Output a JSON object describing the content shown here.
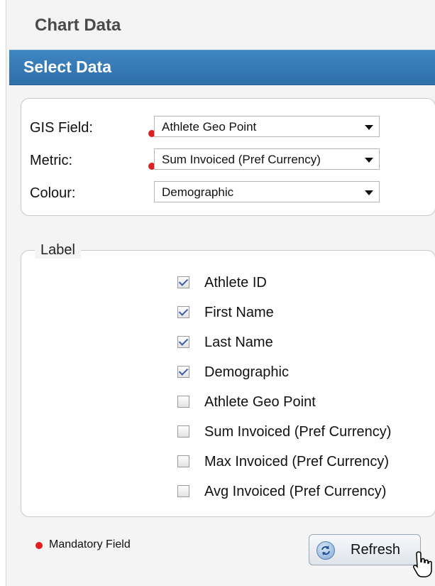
{
  "panel": {
    "title": "Chart Data"
  },
  "section": {
    "title": "Select Data"
  },
  "fields": [
    {
      "label": "GIS Field:",
      "value": "Athlete Geo Point",
      "mandatory": true
    },
    {
      "label": "Metric:",
      "value": "Sum Invoiced (Pref Currency)",
      "mandatory": true
    },
    {
      "label": "Colour:",
      "value": "Demographic",
      "mandatory": false
    }
  ],
  "label_group": {
    "legend": "Label",
    "items": [
      {
        "label": "Athlete ID",
        "checked": true
      },
      {
        "label": "First Name",
        "checked": true
      },
      {
        "label": "Last Name",
        "checked": true
      },
      {
        "label": "Demographic",
        "checked": true
      },
      {
        "label": "Athlete Geo Point",
        "checked": false
      },
      {
        "label": "Sum Invoiced (Pref Currency)",
        "checked": false
      },
      {
        "label": "Max Invoiced (Pref Currency)",
        "checked": false
      },
      {
        "label": "Avg Invoiced (Pref Currency)",
        "checked": false
      }
    ]
  },
  "footer": {
    "mandatory_text": "Mandatory Field",
    "refresh_label": "Refresh"
  },
  "colors": {
    "header_bar": "#2e6fa9",
    "mandatory_dot": "#e02020"
  }
}
